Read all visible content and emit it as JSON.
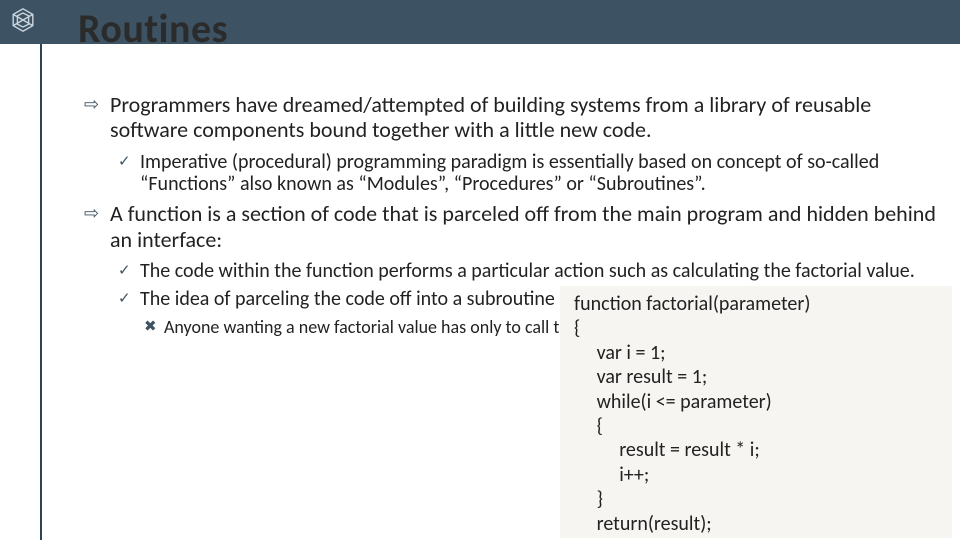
{
  "title": "Routines",
  "bullets": {
    "b1": "Programmers have dreamed/attempted of building systems from a library of reusable software components bound together with a little new code.",
    "b1_1": "Imperative (procedural) programming paradigm is essentially based on concept of so-called “Functions” also known as “Modules”, “Procedures” or “Subroutines”.",
    "b2": "A function is a section of code that is parceled off from the main program and hidden behind an interface:",
    "b2_1": "The code within the function performs a particular action such as calculating the factorial value.",
    "b2_2": "The idea of parceling the code off into a subroutine is that it has only one point of entry.",
    "b2_2_1": "Anyone wanting a new factorial value has only to call the function with the appropriate parameters."
  },
  "code": "function factorial(parameter)\n{\n     var i = 1;\n     var result = 1;\n     while(i <= parameter)\n     {\n          result = result * i;\n          i++;\n     }\n     return(result);\n}"
}
